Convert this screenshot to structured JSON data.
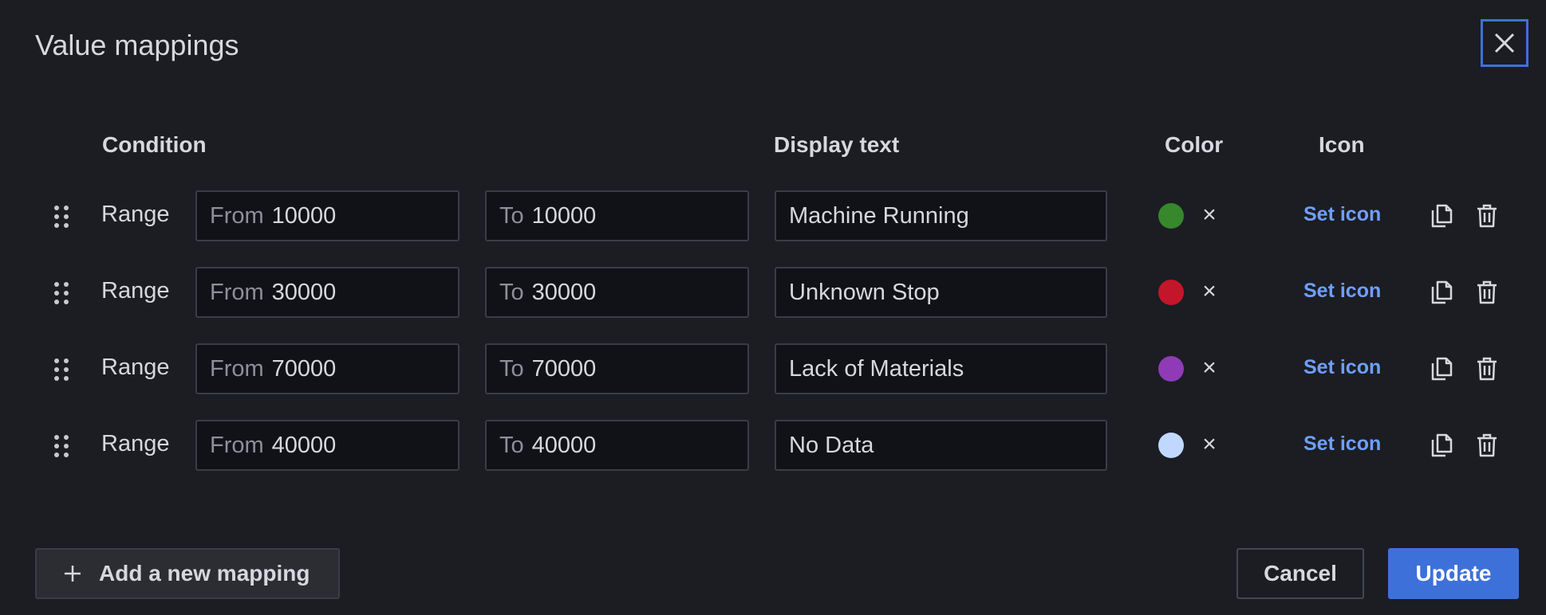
{
  "dialog": {
    "title": "Value mappings"
  },
  "headers": {
    "condition": "Condition",
    "display_text": "Display text",
    "color": "Color",
    "icon": "Icon"
  },
  "mappings": [
    {
      "condition": "Range",
      "from_prefix": "From",
      "from_value": "10000",
      "to_prefix": "To",
      "to_value": "10000",
      "display_text": "Machine Running",
      "color": "#37872d",
      "clear_label": "×",
      "icon_label": "Set icon"
    },
    {
      "condition": "Range",
      "from_prefix": "From",
      "from_value": "30000",
      "to_prefix": "To",
      "to_value": "30000",
      "display_text": "Unknown Stop",
      "color": "#c4162a",
      "clear_label": "×",
      "icon_label": "Set icon"
    },
    {
      "condition": "Range",
      "from_prefix": "From",
      "from_value": "70000",
      "to_prefix": "To",
      "to_value": "70000",
      "display_text": "Lack of Materials",
      "color": "#8f3bb8",
      "clear_label": "×",
      "icon_label": "Set icon"
    },
    {
      "condition": "Range",
      "from_prefix": "From",
      "from_value": "40000",
      "to_prefix": "To",
      "to_value": "40000",
      "display_text": "No Data",
      "color": "#c0d8ff",
      "clear_label": "×",
      "icon_label": "Set icon"
    }
  ],
  "footer": {
    "add_label": "Add a new mapping",
    "cancel_label": "Cancel",
    "update_label": "Update"
  },
  "icons": {
    "close": "close-icon",
    "drag": "drag-handle-icon",
    "copy": "copy-icon",
    "delete": "trash-icon",
    "add": "plus-icon"
  },
  "colors": {
    "background": "#1b1d22",
    "primary": "#3d71d9",
    "link": "#6e9fff"
  }
}
